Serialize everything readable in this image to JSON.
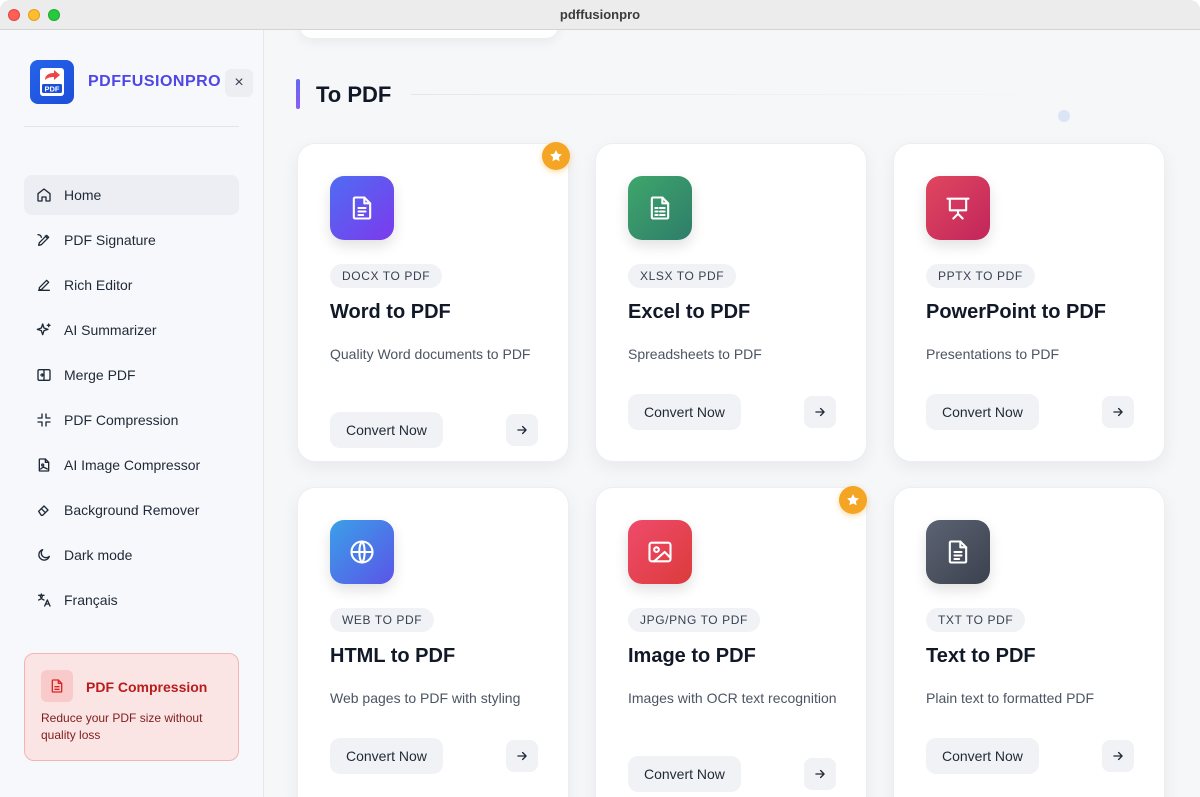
{
  "window": {
    "title": "pdffusionpro"
  },
  "sidebar": {
    "brand": "PDFFUSIONPRO",
    "logo_text": "PDF",
    "close_label": "×",
    "items": [
      {
        "label": "Home",
        "icon": "home-icon"
      },
      {
        "label": "PDF Signature",
        "icon": "signature-icon"
      },
      {
        "label": "Rich Editor",
        "icon": "pencil-icon"
      },
      {
        "label": "AI Summarizer",
        "icon": "sparkles-icon"
      },
      {
        "label": "Merge PDF",
        "icon": "merge-icon"
      },
      {
        "label": "PDF Compression",
        "icon": "compress-icon"
      },
      {
        "label": "AI Image Compressor",
        "icon": "image-file-icon"
      },
      {
        "label": "Background Remover",
        "icon": "eraser-icon"
      },
      {
        "label": "Dark mode",
        "icon": "moon-icon"
      },
      {
        "label": "Français",
        "icon": "translate-icon"
      }
    ],
    "promo": {
      "title": "PDF Compression",
      "text": "Reduce your PDF size without quality loss"
    }
  },
  "main": {
    "section_title": "To PDF",
    "cards": [
      {
        "tag": "DOCX TO PDF",
        "title": "Word to PDF",
        "desc": "Quality Word documents to PDF",
        "button": "Convert Now",
        "featured": true,
        "color_from": "#4f6cf2",
        "color_to": "#7c3aed"
      },
      {
        "tag": "XLSX TO PDF",
        "title": "Excel to PDF",
        "desc": "Spreadsheets to PDF",
        "button": "Convert Now",
        "featured": false,
        "color_from": "#3fa66b",
        "color_to": "#2e7d6a"
      },
      {
        "tag": "PPTX TO PDF",
        "title": "PowerPoint to PDF",
        "desc": "Presentations to PDF",
        "button": "Convert Now",
        "featured": false,
        "color_from": "#e0475f",
        "color_to": "#c2255c"
      },
      {
        "tag": "WEB TO PDF",
        "title": "HTML to PDF",
        "desc": "Web pages to PDF with styling",
        "button": "Convert Now",
        "featured": false,
        "color_from": "#3aa0e8",
        "color_to": "#5b54e8"
      },
      {
        "tag": "JPG/PNG TO PDF",
        "title": "Image to PDF",
        "desc": "Images with OCR text recognition",
        "button": "Convert Now",
        "featured": true,
        "color_from": "#ef4b6c",
        "color_to": "#dc3b3b"
      },
      {
        "tag": "TXT TO PDF",
        "title": "Text to PDF",
        "desc": "Plain text to formatted PDF",
        "button": "Convert Now",
        "featured": false,
        "color_from": "#5c6373",
        "color_to": "#3b414d"
      }
    ]
  }
}
